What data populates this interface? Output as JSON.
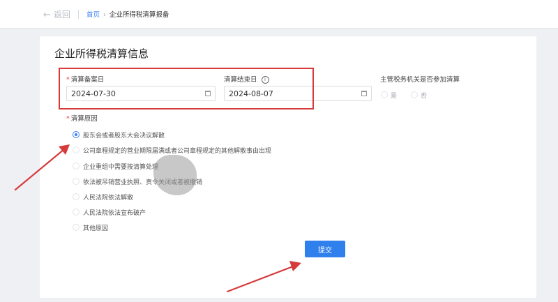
{
  "header": {
    "back_label": "返回",
    "breadcrumb": {
      "home": "首页",
      "separator": "›",
      "current": "企业所得税清算报备"
    }
  },
  "form": {
    "title": "企业所得税清算信息",
    "required_mark": "*",
    "start_date": {
      "label": "清算备案日",
      "value": "2024-07-30"
    },
    "end_date": {
      "label": "清算结束日",
      "value": "2024-08-07",
      "info_icon": "i"
    },
    "tax_authority": {
      "label": "主管税务机关是否参加清算",
      "options": [
        "是",
        "否"
      ],
      "selected": "否"
    },
    "reason": {
      "label": "清算原因",
      "options": [
        {
          "text": "股东会或者股东大会决议解散",
          "selected": true
        },
        {
          "text": "公司章程规定的营业期限届满或者公司章程规定的其他解散事由出现",
          "selected": false
        },
        {
          "text": "企业重组中需要按清算处理",
          "selected": false
        },
        {
          "text": "依法被吊销营业执照、责令关闭或者被撤销",
          "selected": false
        },
        {
          "text": "人民法院依法解散",
          "selected": false
        },
        {
          "text": "人民法院依法宣布破产",
          "selected": false
        },
        {
          "text": "其他原因",
          "selected": false
        }
      ]
    },
    "submit_label": "提交"
  },
  "colors": {
    "accent": "#2f80ed",
    "annotation_red": "#d63b3b"
  }
}
